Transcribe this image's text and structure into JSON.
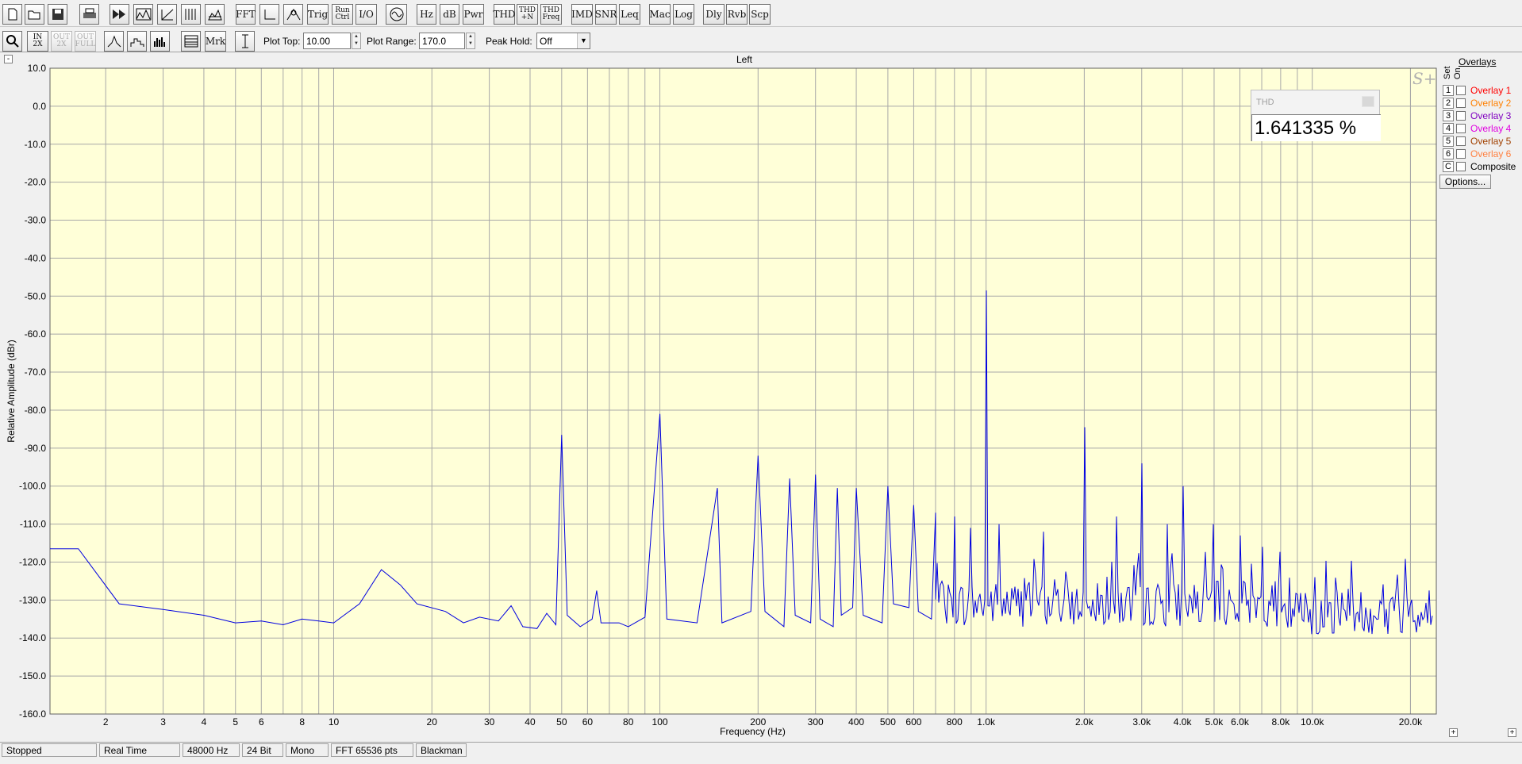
{
  "toolbar": {
    "buttons_row1": [
      {
        "name": "new-button",
        "icon": "new-file-icon",
        "label": ""
      },
      {
        "name": "open-button",
        "icon": "folder-open-icon",
        "label": ""
      },
      {
        "name": "save-button",
        "icon": "floppy-icon",
        "label": ""
      },
      {
        "name": "print-button",
        "icon": "printer-icon",
        "label": ""
      },
      {
        "name": "fast-forward-button",
        "icon": "fast-forward-icon",
        "label": ""
      },
      {
        "name": "spectrum-button",
        "icon": "spectrum-icon",
        "label": ""
      },
      {
        "name": "ramp-button",
        "icon": "ramp-icon",
        "label": ""
      },
      {
        "name": "spectrogram-button",
        "icon": "spectrogram-icon",
        "label": ""
      },
      {
        "name": "3d-button",
        "icon": "waterfall-icon",
        "label": ""
      },
      {
        "name": "fft-button",
        "icon": "",
        "label": "FFT"
      },
      {
        "name": "axes-button",
        "icon": "axes-icon",
        "label": ""
      },
      {
        "name": "peak-button",
        "icon": "peak-icon",
        "label": ""
      },
      {
        "name": "trig-button",
        "icon": "",
        "label": "Trig"
      },
      {
        "name": "run-ctrl-button",
        "icon": "",
        "label": "Run Ctrl"
      },
      {
        "name": "io-button",
        "icon": "",
        "label": "I/O"
      },
      {
        "name": "generator-button",
        "icon": "sine-generator-icon",
        "label": ""
      },
      {
        "name": "hz-button",
        "icon": "",
        "label": "Hz"
      },
      {
        "name": "db-button",
        "icon": "",
        "label": "dB"
      },
      {
        "name": "pwr-button",
        "icon": "",
        "label": "Pwr"
      },
      {
        "name": "thd-button",
        "icon": "",
        "label": "THD"
      },
      {
        "name": "thd-n-button",
        "icon": "",
        "label": "THD +N"
      },
      {
        "name": "thd-freq-button",
        "icon": "",
        "label": "THD Freq"
      },
      {
        "name": "imd-button",
        "icon": "",
        "label": "IMD"
      },
      {
        "name": "snr-button",
        "icon": "",
        "label": "SNR"
      },
      {
        "name": "leq-button",
        "icon": "",
        "label": "Leq"
      },
      {
        "name": "mac-button",
        "icon": "",
        "label": "Mac"
      },
      {
        "name": "log-button",
        "icon": "",
        "label": "Log"
      },
      {
        "name": "dly-button",
        "icon": "",
        "label": "Dly"
      },
      {
        "name": "rvb-button",
        "icon": "",
        "label": "Rvb"
      },
      {
        "name": "scp-button",
        "icon": "",
        "label": "Scp"
      }
    ],
    "buttons_row2": [
      {
        "name": "zoom-button",
        "icon": "magnifier-icon",
        "label": ""
      },
      {
        "name": "zoom-in-2x-button",
        "icon": "zoom-in-2x-icon",
        "label": "IN 2X"
      },
      {
        "name": "zoom-out-2x-button",
        "icon": "zoom-out-2x-icon",
        "label": "OUT 2X"
      },
      {
        "name": "zoom-out-full-button",
        "icon": "zoom-out-full-icon",
        "label": "OUT FULL"
      },
      {
        "name": "line-plot-button",
        "icon": "line-plot-icon",
        "label": ""
      },
      {
        "name": "octave-plot-button",
        "icon": "octave-plot-icon",
        "label": ""
      },
      {
        "name": "bar-plot-button",
        "icon": "bar-plot-icon",
        "label": ""
      },
      {
        "name": "table-button",
        "icon": "table-icon",
        "label": ""
      },
      {
        "name": "mrk-button",
        "icon": "",
        "label": "Mrk"
      },
      {
        "name": "cursor-button",
        "icon": "vertical-cursor-icon",
        "label": ""
      }
    ],
    "plot_top_label": "Plot Top:",
    "plot_top_value": "10.00",
    "plot_range_label": "Plot Range:",
    "plot_range_value": "170.0",
    "peak_hold_label": "Peak Hold:",
    "peak_hold_value": "Off"
  },
  "plot": {
    "title": "Left",
    "logo": "S+",
    "minimize_symbol": "-",
    "expand_symbol": "+"
  },
  "thd_panel": {
    "title": "THD",
    "value": "1.641335 %"
  },
  "overlays": {
    "title": "Overlays",
    "set_label": "Set",
    "on_label": "On",
    "items": [
      {
        "num": "1",
        "label": "Overlay 1",
        "color": "#ff0000"
      },
      {
        "num": "2",
        "label": "Overlay 2",
        "color": "#ff8000"
      },
      {
        "num": "3",
        "label": "Overlay 3",
        "color": "#8000c0"
      },
      {
        "num": "4",
        "label": "Overlay 4",
        "color": "#e000e0"
      },
      {
        "num": "5",
        "label": "Overlay 5",
        "color": "#a04000"
      },
      {
        "num": "6",
        "label": "Overlay 6",
        "color": "#ff8040"
      },
      {
        "num": "C",
        "label": "Composite",
        "color": "#000000"
      }
    ],
    "options_label": "Options..."
  },
  "status_bar": {
    "fields": [
      "Stopped",
      "Real Time",
      "48000 Hz",
      "24 Bit",
      "Mono",
      "FFT 65536 pts",
      "Blackman"
    ]
  },
  "chart_data": {
    "type": "line",
    "title": "Left",
    "xlabel": "Frequency (Hz)",
    "ylabel": "Relative Amplitude (dBr)",
    "x_scale": "log",
    "xlim": [
      1.35,
      24000
    ],
    "ylim": [
      -160,
      10
    ],
    "ytick_labels": [
      "10.0",
      "0.0",
      "-10.0",
      "-20.0",
      "-30.0",
      "-40.0",
      "-50.0",
      "-60.0",
      "-70.0",
      "-80.0",
      "-90.0",
      "-100.0",
      "-110.0",
      "-120.0",
      "-130.0",
      "-140.0",
      "-150.0",
      "-160.0"
    ],
    "xtick_labels": [
      {
        "v": 2,
        "t": "2"
      },
      {
        "v": 3,
        "t": "3"
      },
      {
        "v": 4,
        "t": "4"
      },
      {
        "v": 5,
        "t": "5"
      },
      {
        "v": 6,
        "t": "6"
      },
      {
        "v": 8,
        "t": "8"
      },
      {
        "v": 10,
        "t": "10"
      },
      {
        "v": 20,
        "t": "20"
      },
      {
        "v": 30,
        "t": "30"
      },
      {
        "v": 40,
        "t": "40"
      },
      {
        "v": 50,
        "t": "50"
      },
      {
        "v": 60,
        "t": "60"
      },
      {
        "v": 80,
        "t": "80"
      },
      {
        "v": 100,
        "t": "100"
      },
      {
        "v": 200,
        "t": "200"
      },
      {
        "v": 300,
        "t": "300"
      },
      {
        "v": 400,
        "t": "400"
      },
      {
        "v": 500,
        "t": "500"
      },
      {
        "v": 600,
        "t": "600"
      },
      {
        "v": 800,
        "t": "800"
      },
      {
        "v": 1000,
        "t": "1.0k"
      },
      {
        "v": 2000,
        "t": "2.0k"
      },
      {
        "v": 3000,
        "t": "3.0k"
      },
      {
        "v": 4000,
        "t": "4.0k"
      },
      {
        "v": 5000,
        "t": "5.0k"
      },
      {
        "v": 6000,
        "t": "6.0k"
      },
      {
        "v": 8000,
        "t": "8.0k"
      },
      {
        "v": 10000,
        "t": "10.0k"
      },
      {
        "v": 20000,
        "t": "20.0k"
      }
    ],
    "grid": true,
    "background": "#ffffd8",
    "trace_color": "#0000e0",
    "series": [
      {
        "values_baseline": [
          [
            1.35,
            -116.5
          ],
          [
            1.65,
            -116.5
          ],
          [
            2.2,
            -131
          ],
          [
            3,
            -132.5
          ],
          [
            4,
            -134
          ],
          [
            5,
            -136
          ],
          [
            6,
            -135.5
          ],
          [
            7,
            -136.5
          ],
          [
            8,
            -135
          ],
          [
            9,
            -135.5
          ],
          [
            10,
            -136
          ],
          [
            12,
            -131
          ],
          [
            14,
            -122
          ],
          [
            16,
            -126
          ],
          [
            18,
            -131
          ],
          [
            22,
            -133
          ],
          [
            25,
            -136
          ],
          [
            28,
            -134.5
          ],
          [
            32,
            -135.5
          ],
          [
            35,
            -131.5
          ],
          [
            38,
            -137
          ],
          [
            42,
            -137.5
          ],
          [
            45,
            -133.5
          ],
          [
            48,
            -136.5
          ],
          [
            50,
            -86.5
          ],
          [
            52,
            -134
          ],
          [
            57,
            -137
          ],
          [
            62,
            -135
          ],
          [
            64,
            -127.5
          ],
          [
            66,
            -136
          ],
          [
            75,
            -136
          ],
          [
            80,
            -137
          ],
          [
            90,
            -134.5
          ],
          [
            100,
            -81
          ],
          [
            105,
            -135
          ],
          [
            130,
            -136
          ],
          [
            150,
            -100.5
          ],
          [
            155,
            -136
          ],
          [
            190,
            -133
          ],
          [
            200,
            -92
          ],
          [
            210,
            -133
          ],
          [
            240,
            -137
          ],
          [
            250,
            -98
          ],
          [
            260,
            -134
          ],
          [
            290,
            -136
          ],
          [
            300,
            -97
          ],
          [
            310,
            -135
          ],
          [
            340,
            -137
          ],
          [
            350,
            -100.5
          ],
          [
            360,
            -134
          ],
          [
            390,
            -132
          ],
          [
            400,
            -100.5
          ],
          [
            420,
            -134
          ],
          [
            480,
            -136
          ],
          [
            500,
            -100
          ],
          [
            520,
            -131
          ],
          [
            580,
            -132
          ],
          [
            600,
            -105
          ],
          [
            620,
            -133
          ],
          [
            680,
            -135
          ],
          [
            700,
            -107
          ],
          [
            720,
            -130
          ],
          [
            780,
            -131
          ],
          [
            800,
            -108
          ],
          [
            820,
            -132
          ],
          [
            880,
            -131
          ],
          [
            900,
            -111
          ],
          [
            920,
            -129
          ],
          [
            980,
            -132
          ],
          [
            1000,
            -48.5
          ],
          [
            1010,
            -135
          ],
          [
            1100,
            -110
          ],
          [
            1200,
            -129
          ],
          [
            1500,
            -112
          ],
          [
            1800,
            -127
          ],
          [
            2000,
            -84.5
          ],
          [
            2050,
            -133
          ],
          [
            2500,
            -108
          ],
          [
            2800,
            -128
          ],
          [
            3000,
            -94
          ],
          [
            3050,
            -132
          ],
          [
            3600,
            -110
          ],
          [
            4000,
            -100
          ],
          [
            4100,
            -131
          ],
          [
            5000,
            -110
          ],
          [
            6000,
            -113
          ],
          [
            7000,
            -116
          ],
          [
            8000,
            -118
          ],
          [
            10000,
            -119
          ],
          [
            12000,
            -120
          ],
          [
            16000,
            -121
          ],
          [
            20000,
            -121
          ],
          [
            24000,
            -129
          ]
        ]
      }
    ]
  }
}
